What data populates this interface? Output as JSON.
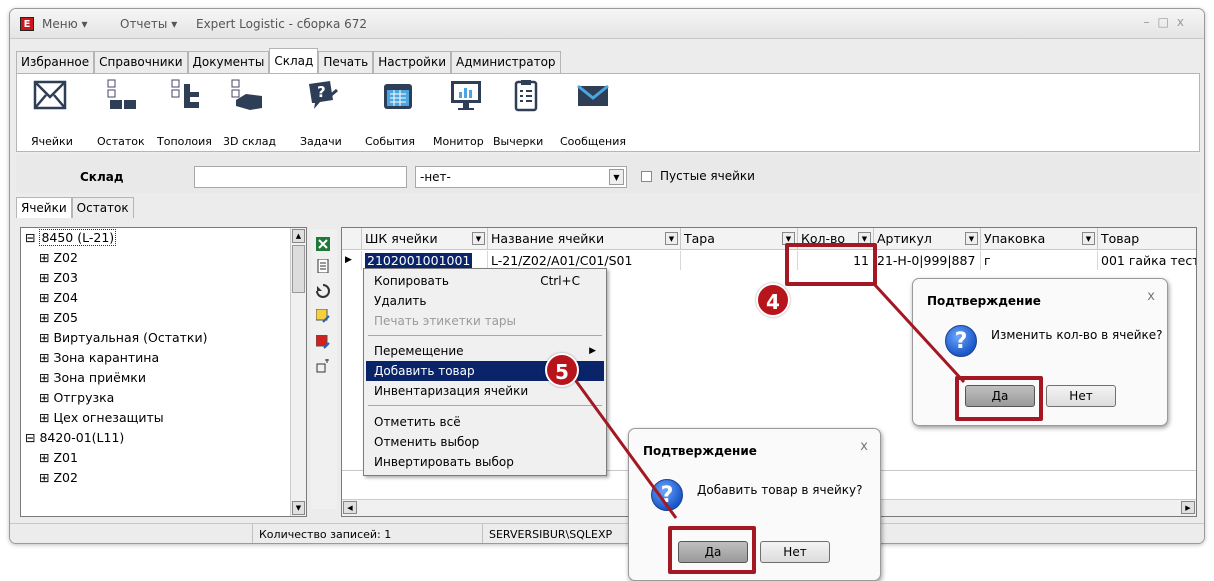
{
  "window": {
    "logo": "E",
    "menu_label": "Меню",
    "reports_label": "Отчеты",
    "title": "Expert Logistic - сборка 672"
  },
  "main_tabs": [
    "Избранное",
    "Справочники",
    "Документы",
    "Склад",
    "Печать",
    "Настройки",
    "Администратор"
  ],
  "ribbon": [
    {
      "label": "Ячейки",
      "icon": "mail-cells-icon"
    },
    {
      "label": "Остаток",
      "icon": "stock-icon"
    },
    {
      "label": "Тополоия",
      "icon": "topology-icon"
    },
    {
      "label": "3D склад",
      "icon": "3d-warehouse-icon"
    },
    {
      "label": "Задачи",
      "icon": "tasks-icon"
    },
    {
      "label": "События",
      "icon": "calendar-icon"
    },
    {
      "label": "Монитор",
      "icon": "monitor-icon"
    },
    {
      "label": "Вычерки",
      "icon": "clipboard-icon"
    },
    {
      "label": "Сообщения",
      "icon": "envelope-icon"
    }
  ],
  "filter": {
    "label": "Склад",
    "warehouse_value": "",
    "select_value": "-нет-",
    "checkbox_label": "Пустые ячейки"
  },
  "sub_tabs": [
    "Ячейки",
    "Остаток"
  ],
  "tree": [
    "8450 (L-21)",
    "Z02",
    "Z03",
    "Z04",
    "Z05",
    "Виртуальная (Остатки)",
    "Зона карантина",
    "Зона приёмки",
    "Отгрузка",
    "Цех огнезащиты",
    "8420-01(L11)",
    "Z01",
    "Z02"
  ],
  "grid": {
    "columns": [
      "ШК ячейки",
      "Название ячейки",
      "Тара",
      "Кол-во",
      "Артикул",
      "Упаковка",
      "Товар"
    ],
    "row": [
      "2102001001001",
      "L-21/Z02/A01/C01/S01",
      "",
      "11",
      "21-Н-0|999|887",
      "г",
      "001 гайка тест"
    ]
  },
  "context_menu": {
    "items": [
      {
        "label": "Копировать",
        "shortcut": "Ctrl+C"
      },
      {
        "label": "Удалить"
      },
      {
        "label": "Печать этикетки тары"
      },
      {
        "label": "Перемещение"
      },
      {
        "label": "Добавить товар"
      },
      {
        "label": "Инвентаризация ячейки"
      },
      {
        "label": "Отметить всё"
      },
      {
        "label": "Отменить выбор"
      },
      {
        "label": "Инвертировать выбор"
      }
    ]
  },
  "dialog_qty": {
    "title": "Подтверждение",
    "close": "x",
    "message": "Изменить кол-во в ячейке?",
    "yes": "Да",
    "no": "Нет"
  },
  "dialog_add": {
    "title": "Подтверждение",
    "close": "x",
    "message": "Добавить товар в ячейку?",
    "yes": "Да",
    "no": "Нет"
  },
  "status": {
    "records": "Количество записей: 1",
    "server": "SERVERSIBUR\\SQLEXP"
  },
  "annotations": {
    "step4": "4",
    "step5": "5",
    "color": "#a31822"
  }
}
